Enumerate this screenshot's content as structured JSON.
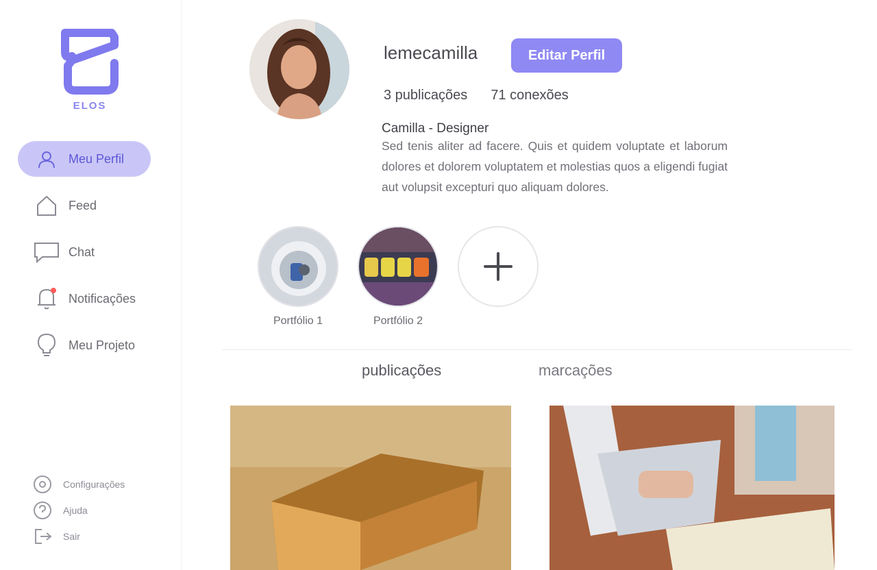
{
  "sidebar": {
    "logo_text": "ELOS",
    "items": [
      {
        "label": "Meu Perfil",
        "icon": "user-icon",
        "active": true
      },
      {
        "label": "Feed",
        "icon": "home-icon",
        "active": false
      },
      {
        "label": "Chat",
        "icon": "chat-icon",
        "active": false
      },
      {
        "label": "Notificações",
        "icon": "bell-icon",
        "active": false,
        "has_badge": true
      },
      {
        "label": "Meu Projeto",
        "icon": "lightbulb-icon",
        "active": false
      }
    ],
    "bottom_items": [
      {
        "label": "Configurações",
        "icon": "gear-icon"
      },
      {
        "label": "Ajuda",
        "icon": "help-icon"
      },
      {
        "label": "Sair",
        "icon": "logout-icon"
      }
    ]
  },
  "profile": {
    "username": "lemecamilla",
    "edit_button": "Editar Perfil",
    "posts_count": "3 publicações",
    "connections": "71 conexões",
    "bio_name": "Camilla - Designer",
    "bio_text": "Sed tenis aliter ad facere. Quis et quidem voluptate et laborum dolores et dolorem voluptatem et molestias quos a eligendi fugiat aut volupsit excepturi quo aliquam dolores."
  },
  "highlights": [
    {
      "label": "Portfólio 1"
    },
    {
      "label": "Portfólio 2"
    }
  ],
  "tabs": {
    "publications": "publicações",
    "mentions": "marcações"
  },
  "colors": {
    "accent": "#8f89f3",
    "active_nav_bg": "#c9c6f7",
    "notification_badge": "#ff5a5a"
  }
}
